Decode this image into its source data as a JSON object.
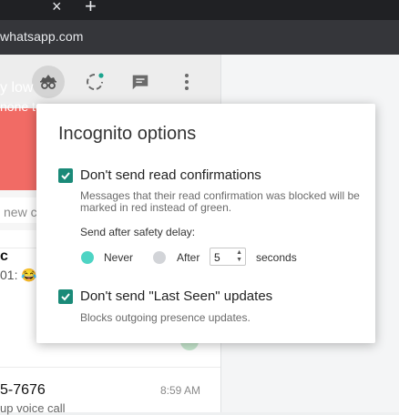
{
  "browser": {
    "tab_close": "×",
    "new_tab": "+",
    "url": "whatsapp.com"
  },
  "whatsapp": {
    "banner": {
      "line1": "y low",
      "line2": "none to"
    },
    "search_placeholder": "new c",
    "chats": [
      {
        "name": "c",
        "preview": "01: 😂"
      },
      {
        "name": "5-7676",
        "preview": "up voice call",
        "time": "8:59 AM"
      }
    ]
  },
  "popup": {
    "title": "Incognito options",
    "read_confirmations": {
      "label": "Don't send read confirmations",
      "checked": true,
      "description": "Messages that their read confirmation was blocked will be marked in red instead of green.",
      "delay_label": "Send after safety delay:",
      "options": [
        {
          "label": "Never",
          "selected": true
        },
        {
          "label": "After",
          "selected": false
        }
      ],
      "delay_value": "5",
      "unit": "seconds"
    },
    "last_seen": {
      "label": "Don't send \"Last Seen\" updates",
      "checked": true,
      "description": "Blocks outgoing presence updates."
    }
  },
  "colors": {
    "checkbox": "#1a8a78",
    "radio_selected": "#4ed4c4",
    "banner": "#f16b65"
  },
  "icons": [
    "close-icon",
    "plus-icon",
    "incognito-icon",
    "refresh-icon",
    "chat-icon",
    "menu-icon",
    "check-icon"
  ]
}
